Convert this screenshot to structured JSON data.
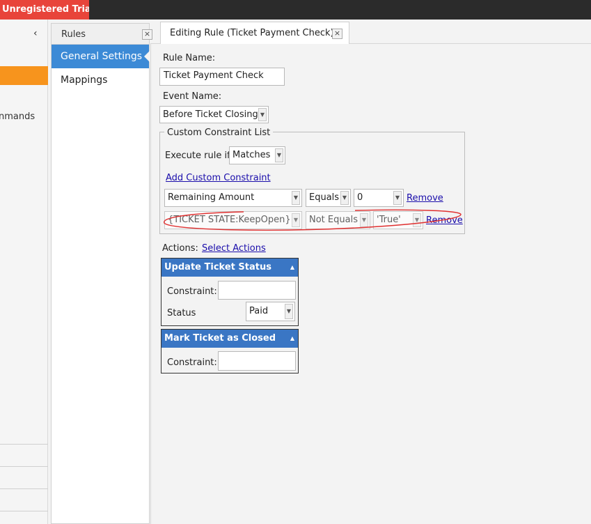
{
  "titlebar": {
    "trial_label": "Unregistered Trial"
  },
  "leftnav": {
    "collapse_glyph": "‹",
    "partial_item_label": "nmands"
  },
  "rules_panel": {
    "title": "Rules",
    "close_glyph": "×",
    "items": [
      {
        "label": "General Settings"
      },
      {
        "label": "Mappings"
      }
    ]
  },
  "editor": {
    "tab_title": "Editing Rule (Ticket Payment Check)",
    "tab_close_glyph": "×",
    "rule_name_label": "Rule Name:",
    "rule_name_value": "Ticket Payment Check",
    "event_name_label": "Event Name:",
    "event_name_value": "Before Ticket Closing",
    "constraints": {
      "legend": "Custom Constraint List",
      "execute_label": "Execute rule if",
      "execute_value": "Matches",
      "add_link": "Add Custom Constraint",
      "rows": [
        {
          "field": "Remaining Amount",
          "operator": "Equals",
          "value": "0",
          "remove": "Remove"
        },
        {
          "field": "{TICKET STATE:KeepOpen}",
          "operator": "Not Equals",
          "value": "'True'",
          "remove": "Remove"
        }
      ]
    },
    "actions_label": "Actions:",
    "select_actions_link": "Select Actions",
    "actions": [
      {
        "title": "Update Ticket Status",
        "constraint_label": "Constraint:",
        "constraint_value": "",
        "status_label": "Status",
        "status_value": "Paid"
      },
      {
        "title": "Mark Ticket as Closed",
        "constraint_label": "Constraint:",
        "constraint_value": ""
      }
    ]
  },
  "icons": {
    "dropdown": "chevron-down-icon",
    "collapse": "chevron-left-icon",
    "close": "close-icon",
    "section_collapse": "triangle-up-icon"
  },
  "colors": {
    "accent_orange": "#f7941d",
    "selection_blue": "#3c8ad6",
    "action_header_blue": "#3a76c4",
    "trial_red": "#e8443a",
    "annotation_red": "#e03030"
  }
}
